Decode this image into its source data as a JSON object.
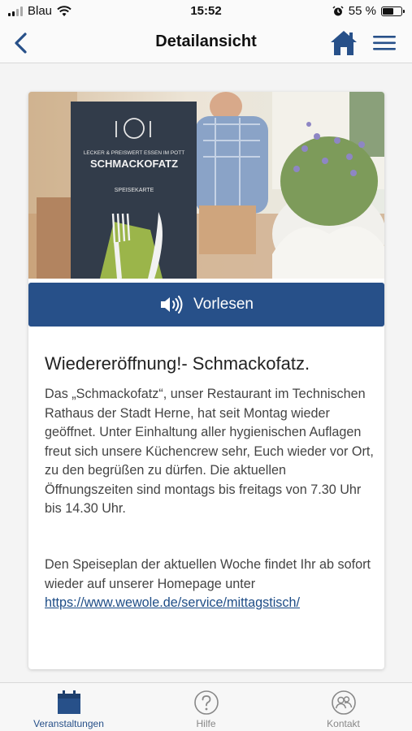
{
  "status_bar": {
    "carrier": "Blau",
    "time": "15:52",
    "battery": "55 %",
    "battery_level": 0.55
  },
  "nav": {
    "title": "Detailansicht"
  },
  "article": {
    "read_aloud_label": "Vorlesen",
    "title": "Wiedereröffnung!- Schmackofatz.",
    "paragraph1": "Das „Schmackofatz“, unser Restaurant im Technischen Rathaus der Stadt Herne, hat seit Montag wieder geöffnet. Unter Einhaltung aller hygienischen Auflagen freut sich unsere Küchencrew sehr, Euch wieder vor Ort, zu den begrüßen zu dürfen. Die aktuellen Öffnungszeiten sind montags bis freitags von 7.30 Uhr bis 14.30 Uhr.",
    "paragraph2_text": "Den Speiseplan der aktuellen Woche findet Ihr ab sofort wieder auf unserer Homepage unter",
    "paragraph2_link": "https://www.wewole.de/service/mittagstisch/"
  },
  "hero_image": {
    "menu_tagline": "LECKER & PREISWERT ESSEN IM POTT",
    "menu_brand": "SCHMACKOFATZ",
    "menu_sub": "SPEISEKARTE"
  },
  "tabs": [
    {
      "label": "Veranstaltungen",
      "icon": "calendar-icon",
      "active": true
    },
    {
      "label": "Hilfe",
      "icon": "help-icon",
      "active": false
    },
    {
      "label": "Kontakt",
      "icon": "contact-icon",
      "active": false
    }
  ],
  "colors": {
    "primary": "#275089",
    "link": "#1d4c86",
    "inactive": "#888888"
  }
}
